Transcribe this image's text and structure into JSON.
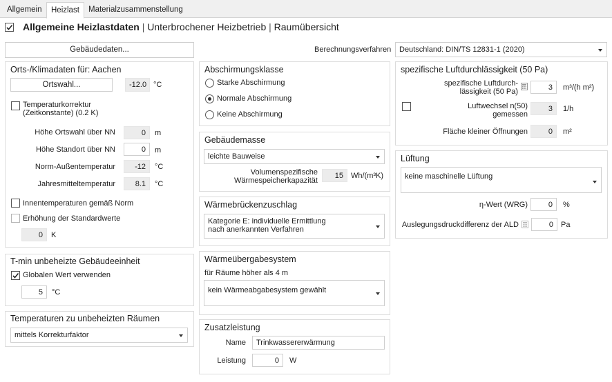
{
  "tabs": [
    "Allgemein",
    "Heizlast",
    "Materialzusammenstellung"
  ],
  "header": {
    "title": "Allgemeine Heizlastdaten",
    "sep": "|",
    "link1": "Unterbrochener Heizbetrieb",
    "link2": "Raumübersicht"
  },
  "gebaeude_button": "Gebäudedaten...",
  "berechnung": {
    "label": "Berechnungsverfahren",
    "value": "Deutschland: DIN/TS 12831-1 (2020)"
  },
  "orts": {
    "title": "Orts-/Klimadaten für: Aachen",
    "btn": "Ortswahl...",
    "temp": "-12.0",
    "temp_unit": "°C",
    "korrektur": "Temperaturkorrektur\n(Zeitkonstante) (0.2 K)",
    "hoehe_ort_label": "Höhe Ortswahl über NN",
    "hoehe_ort_value": "0",
    "hoehe_std_label": "Höhe Standort über NN",
    "hoehe_std_value": "0",
    "m": "m",
    "norm_label": "Norm-Außentemperatur",
    "norm_value": "-12",
    "jahr_label": "Jahresmitteltemperatur",
    "jahr_value": "8.1",
    "c": "°C",
    "innen": "Innentemperaturen gemäß Norm",
    "erhoehung": "Erhöhung der Standardwerte",
    "k_value": "0",
    "k_unit": "K"
  },
  "tmin": {
    "title": "T-min unbeheizte Gebäudeeinheit",
    "global": "Globalen Wert verwenden",
    "value": "5",
    "unit": "°C"
  },
  "unbeheizt": {
    "title": "Temperaturen zu unbeheizten Räumen",
    "value": "mittels Korrekturfaktor"
  },
  "abschirmung": {
    "title": "Abschirmungsklasse",
    "options": [
      "Starke Abschirmung",
      "Normale Abschirmung",
      "Keine Abschirmung"
    ]
  },
  "masse": {
    "title": "Gebäudemasse",
    "value": "leichte Bauweise",
    "label": "Volumenspezifische\nWärmespeicherkapazität",
    "num": "15",
    "unit": "Wh/(m³K)"
  },
  "waermebruecken": {
    "title": "Wärmebrückenzuschlag",
    "value": "Kategorie E: individuelle Ermittlung\nnach anerkannten Verfahren"
  },
  "waermeuebergabe": {
    "title": "Wärmeübergabesystem",
    "sub": "für Räume höher als 4 m",
    "value": "kein Wärmeabgabesystem gewählt"
  },
  "zusatz": {
    "title": "Zusatzleistung",
    "name_label": "Name",
    "name_value": "Trinkwassererwärmung",
    "leistung_label": "Leistung",
    "leistung_value": "0",
    "unit": "W"
  },
  "luft": {
    "title": "spezifische Luftdurchlässigkeit (50 Pa)",
    "label1": "spezifische Luftdurch-\nlässigkeit (50 Pa)",
    "value1": "3",
    "unit1": "m³/(h m²)",
    "label2": "Luftwechsel n(50)\ngemessen",
    "value2": "3",
    "unit2": "1/h",
    "label3": "Fläche kleiner Öffnungen",
    "value3": "0",
    "unit3": "m²"
  },
  "lueftung": {
    "title": "Lüftung",
    "value": "keine maschinelle Lüftung",
    "eta_label": "η-Wert (WRG)",
    "eta_value": "0",
    "eta_unit": "%",
    "ald_label": "Auslegungsdruckdifferenz der ALD",
    "ald_value": "0",
    "ald_unit": "Pa"
  }
}
